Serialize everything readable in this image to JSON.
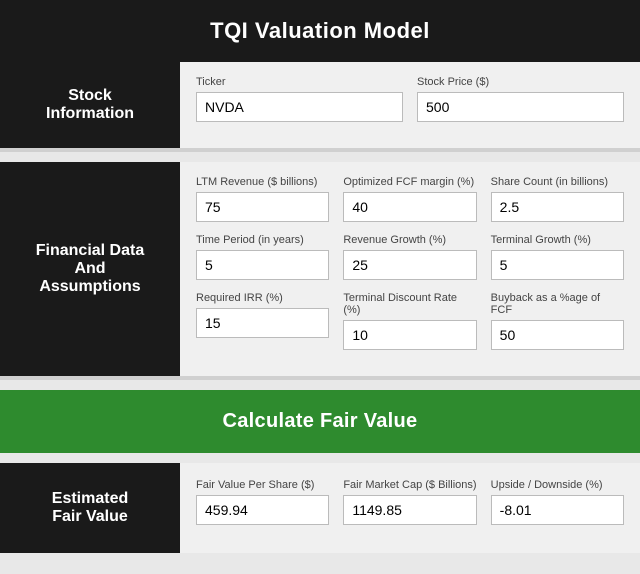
{
  "header": {
    "title": "TQI Valuation Model"
  },
  "stock_section": {
    "label": "Stock\nInformation",
    "fields": [
      {
        "label": "Ticker",
        "value": "NVDA",
        "name": "ticker-input"
      },
      {
        "label": "Stock Price ($)",
        "value": "500",
        "name": "stock-price-input"
      }
    ]
  },
  "financial_section": {
    "label": "Financial Data\nAnd\nAssumptions",
    "rows": [
      [
        {
          "label": "LTM Revenue ($ billions)",
          "value": "75",
          "name": "ltm-revenue-input"
        },
        {
          "label": "Optimized FCF margin (%)",
          "value": "40",
          "name": "fcf-margin-input"
        },
        {
          "label": "Share Count (in billions)",
          "value": "2.5",
          "name": "share-count-input"
        }
      ],
      [
        {
          "label": "Time Period (in years)",
          "value": "5",
          "name": "time-period-input"
        },
        {
          "label": "Revenue Growth (%)",
          "value": "25",
          "name": "revenue-growth-input"
        },
        {
          "label": "Terminal Growth (%)",
          "value": "5",
          "name": "terminal-growth-input"
        }
      ],
      [
        {
          "label": "Required IRR (%)",
          "value": "15",
          "name": "required-irr-input"
        },
        {
          "label": "Terminal Discount Rate (%)",
          "value": "10",
          "name": "terminal-discount-input"
        },
        {
          "label": "Buyback as a %age of FCF",
          "value": "50",
          "name": "buyback-input"
        }
      ]
    ]
  },
  "calculate_btn": {
    "label": "Calculate Fair Value"
  },
  "estimated_section": {
    "label": "Estimated\nFair Value",
    "fields": [
      {
        "label": "Fair Value Per Share ($)",
        "value": "459.94",
        "name": "fair-value-per-share-input"
      },
      {
        "label": "Fair Market Cap ($ Billions)",
        "value": "1149.85",
        "name": "fair-market-cap-input"
      },
      {
        "label": "Upside / Downside (%)",
        "value": "-8.01",
        "name": "upside-downside-input"
      }
    ]
  }
}
